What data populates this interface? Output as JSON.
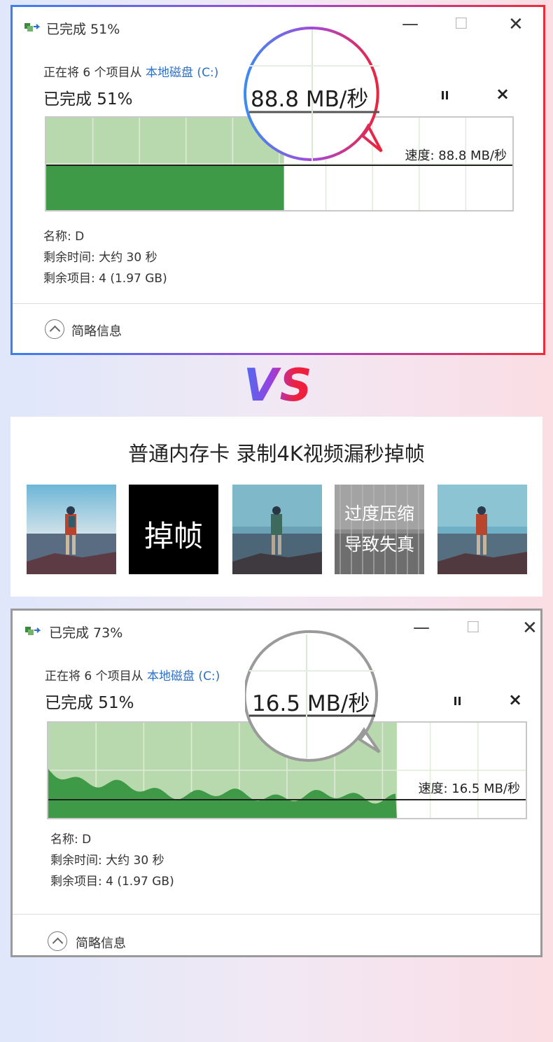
{
  "dialog_top": {
    "window_title": "已完成 51%",
    "copy_line_prefix": "正在将 6 个项目从 ",
    "copy_source": "本地磁盘 (C:)",
    "progress_label": "已完成 51%",
    "pause_icon": "pause-icon",
    "cancel_symbol": "×",
    "speed_label": "速度: 88.8 MB/秒",
    "magnified_speed": "88.8 MB/秒",
    "name_line": "名称: D",
    "time_left_line": "剩余时间: 大约 30 秒",
    "items_left_line": "剩余项目: 4 (1.97 GB)",
    "details_toggle": "简略信息",
    "progress_percent": 51,
    "progress_shown_percent": 51,
    "colors": {
      "fill": "#3f9a48",
      "fill_light": "#b8d9ad",
      "border_gradient": [
        "#3b7ff0",
        "#ef2b3a"
      ]
    }
  },
  "vs_label": "VS",
  "comparison": {
    "title": "普通内存卡  录制4K视频漏秒掉帧",
    "thumbnails": [
      {
        "kind": "photo"
      },
      {
        "kind": "text",
        "label": "掉帧"
      },
      {
        "kind": "photo"
      },
      {
        "kind": "text-overlay",
        "line1": "过度压缩",
        "line2": "导致失真"
      },
      {
        "kind": "photo"
      }
    ]
  },
  "dialog_bottom": {
    "window_title": "已完成 73%",
    "copy_line_prefix": "正在将 6 个项目从 ",
    "copy_source": "本地磁盘 (C:)",
    "progress_label": "已完成 51%",
    "pause_icon": "pause-icon",
    "cancel_symbol": "×",
    "speed_label": "速度: 16.5 MB/秒",
    "magnified_speed": "16.5 MB/秒",
    "name_line": "名称: D",
    "time_left_line": "剩余时间: 大约 30 秒",
    "items_left_line": "剩余项目: 4 (1.97 GB)",
    "details_toggle": "简略信息",
    "progress_percent": 73,
    "colors": {
      "fill": "#3f9a48",
      "fill_light": "#b8d9ad",
      "border": "#9a9a9a"
    }
  },
  "window_controls": {
    "minimize": "—",
    "maximize": "☐",
    "close": "✕"
  }
}
